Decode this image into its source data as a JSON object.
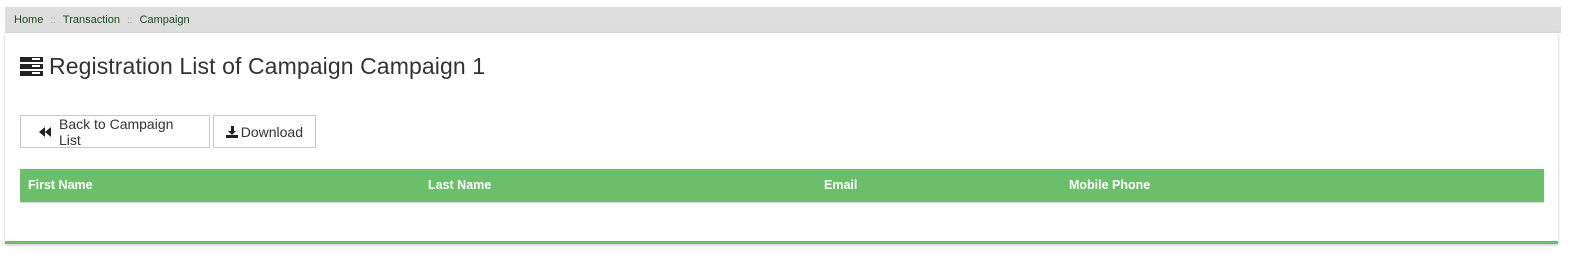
{
  "breadcrumb": {
    "items": [
      "Home",
      "Transaction",
      "Campaign"
    ],
    "separator": "::"
  },
  "page": {
    "title": "Registration List of Campaign Campaign 1",
    "title_icon": "list-icon"
  },
  "toolbar": {
    "back_label": "Back to Campaign List",
    "back_icon": "fast-backward-icon",
    "download_label": "Download",
    "download_icon": "download-icon"
  },
  "table": {
    "columns": [
      "First Name",
      "Last Name",
      "Email",
      "Mobile Phone"
    ],
    "rows": []
  },
  "colors": {
    "accent": "#6cbf6a",
    "breadcrumb_bg": "#dddddd",
    "text": "#333333"
  }
}
